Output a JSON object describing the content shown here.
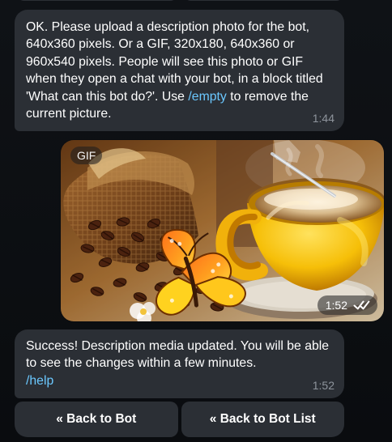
{
  "chat": {
    "intro_text_before_link": "OK. Please upload a description photo for the bot, 640x360 pixels. Or a GIF,  320x180, 640x360 or 960x540 pixels. People will see this photo or GIF when they open a chat with your bot, in a block titled 'What can this bot do?'. Use ",
    "intro_link": "/empty",
    "intro_text_after_link": " to remove the current picture.",
    "intro_time": "1:44",
    "media_badge": "GIF",
    "media_time": "1:52",
    "success_text": "Success! Description media updated. You will be able to see the changes within a few minutes.",
    "success_link": "/help",
    "success_time": "1:52"
  },
  "keyboard": {
    "back_to_bot": "« Back to Bot",
    "back_to_bot_list": "« Back to Bot List"
  },
  "icons": {
    "read_checks": "double-check-icon"
  },
  "colors": {
    "background": "#0b0d10",
    "bubble": "#2b2f35",
    "link": "#6bc8ff",
    "muted": "#8e949c"
  }
}
